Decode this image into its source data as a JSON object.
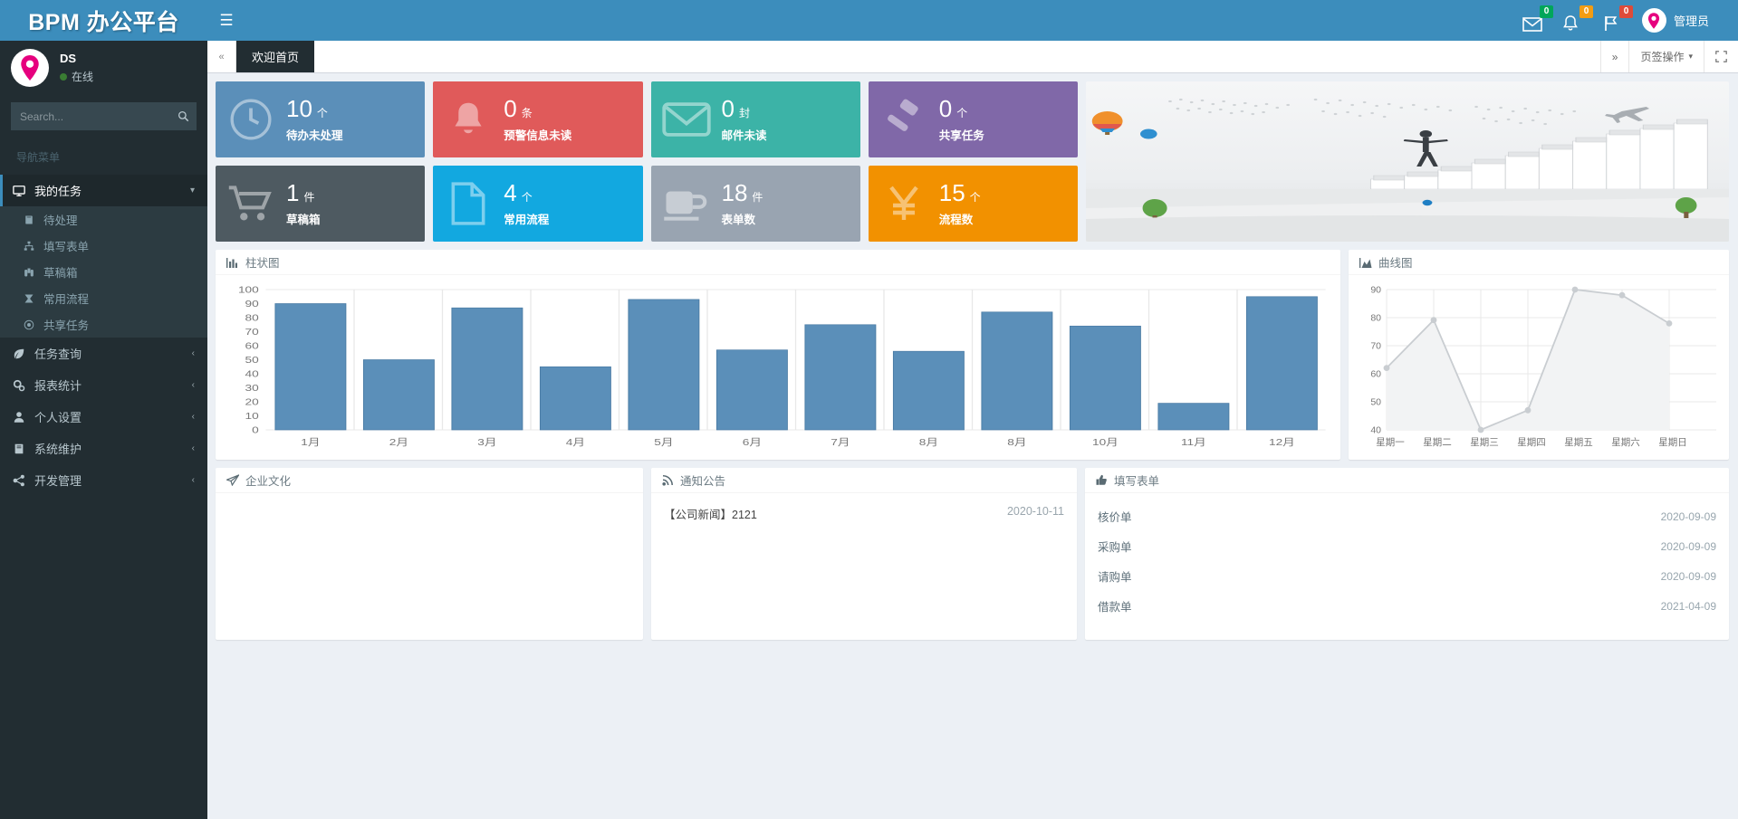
{
  "header": {
    "logo": "BPM 办公平台",
    "hamburger_icon": "hamburger-icon",
    "mail_badge": "0",
    "bell_badge": "0",
    "flag_badge": "0",
    "user_name": "管理员",
    "accent_color": "#3c8dbc"
  },
  "sidebar": {
    "user": {
      "name": "DS",
      "status": "在线"
    },
    "search_placeholder": "Search...",
    "menu_header": "导航菜单",
    "items": [
      {
        "label": "我的任务",
        "icon": "desktop-icon",
        "active": true,
        "arrow": "chevron-down-icon"
      },
      {
        "label": "任务查询",
        "icon": "leaf-icon",
        "active": false,
        "arrow": "chevron-left-icon"
      },
      {
        "label": "报表统计",
        "icon": "gears-icon",
        "active": false,
        "arrow": "chevron-left-icon"
      },
      {
        "label": "个人设置",
        "icon": "user-icon",
        "active": false,
        "arrow": "chevron-left-icon"
      },
      {
        "label": "系统维护",
        "icon": "book-icon",
        "active": false,
        "arrow": "chevron-left-icon"
      },
      {
        "label": "开发管理",
        "icon": "share-icon",
        "active": false,
        "arrow": "chevron-left-icon"
      }
    ],
    "submenu": [
      {
        "label": "待处理",
        "icon": "book-icon"
      },
      {
        "label": "填写表单",
        "icon": "sitemap-icon"
      },
      {
        "label": "草稿箱",
        "icon": "binoculars-icon"
      },
      {
        "label": "常用流程",
        "icon": "flow-icon"
      },
      {
        "label": "共享任务",
        "icon": "circle-icon"
      }
    ]
  },
  "tabbar": {
    "collapse_icon": "double-left-icon",
    "tabs": [
      {
        "label": "欢迎首页",
        "active": true
      }
    ],
    "scroll_right_icon": "double-right-icon",
    "actions_label": "页签操作",
    "fullscreen_icon": "expand-icon"
  },
  "stat_cards": [
    {
      "value": "10",
      "unit": "个",
      "label": "待办未处理",
      "color": "#5b8fb9",
      "icon": "clock-icon"
    },
    {
      "value": "0",
      "unit": "条",
      "label": "预警信息未读",
      "color": "#e05a5a",
      "icon": "bell-icon"
    },
    {
      "value": "0",
      "unit": "封",
      "label": "邮件未读",
      "color": "#3cb3a7",
      "icon": "envelope-icon"
    },
    {
      "value": "0",
      "unit": "个",
      "label": "共享任务",
      "color": "#8068a8",
      "icon": "gavel-icon"
    },
    {
      "value": "1",
      "unit": "件",
      "label": "草稿箱",
      "color": "#4e5a61",
      "icon": "cart-icon"
    },
    {
      "value": "4",
      "unit": "个",
      "label": "常用流程",
      "color": "#12a8e0",
      "icon": "file-icon"
    },
    {
      "value": "18",
      "unit": "件",
      "label": "表单数",
      "color": "#99a4b1",
      "icon": "coffee-icon"
    },
    {
      "value": "15",
      "unit": "个",
      "label": "流程数",
      "color": "#f29100",
      "icon": "yen-icon"
    }
  ],
  "panels": {
    "bar_title": "柱状图",
    "bar_icon": "bar-chart-icon",
    "line_title": "曲线图",
    "line_icon": "area-chart-icon",
    "culture_title": "企业文化",
    "culture_icon": "paper-plane-icon",
    "notice_title": "通知公告",
    "notice_icon": "rss-icon",
    "forms_title": "填写表单",
    "forms_icon": "thumbs-up-icon"
  },
  "notices": [
    {
      "text": "【公司新闻】2121",
      "date": "2020-10-11"
    }
  ],
  "forms": [
    {
      "name": "核价单",
      "date": "2020-09-09"
    },
    {
      "name": "采购单",
      "date": "2020-09-09"
    },
    {
      "name": "请购单",
      "date": "2020-09-09"
    },
    {
      "name": "借款单",
      "date": "2021-04-09"
    }
  ],
  "chart_data": [
    {
      "type": "bar",
      "title": "柱状图",
      "categories": [
        "1月",
        "2月",
        "3月",
        "4月",
        "5月",
        "6月",
        "7月",
        "8月",
        "8月",
        "10月",
        "11月",
        "12月"
      ],
      "values": [
        90,
        50,
        87,
        45,
        93,
        57,
        75,
        56,
        84,
        74,
        19,
        95
      ],
      "ylim": [
        0,
        100
      ],
      "yticks": [
        0,
        10,
        20,
        30,
        40,
        50,
        60,
        70,
        80,
        90,
        100
      ],
      "xlabel": "",
      "ylabel": "",
      "grid": true,
      "bar_color": "#5b8fb9"
    },
    {
      "type": "line",
      "title": "曲线图",
      "categories": [
        "星期一",
        "星期二",
        "星期三",
        "星期四",
        "星期五",
        "星期六",
        "星期日"
      ],
      "values": [
        68,
        85,
        40,
        47,
        90,
        88,
        78
      ],
      "ylim": [
        40,
        90
      ],
      "yticks": [
        40,
        50,
        60,
        70,
        80,
        90
      ],
      "xlabel": "",
      "ylabel": "",
      "grid": true,
      "line_color": "#c9cdd1"
    }
  ]
}
